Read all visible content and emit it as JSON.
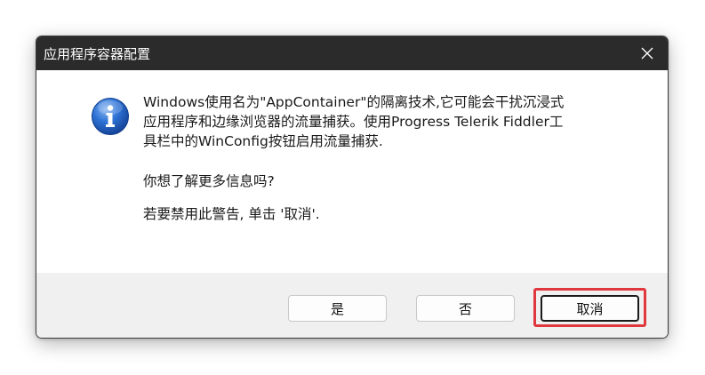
{
  "window": {
    "title": "应用程序容器配置"
  },
  "message": {
    "lines": [
      "Windows使用名为\"AppContainer\"的隔离技术,它可能会干扰沉浸式",
      "应用程序和边缘浏览器的流量捕获。使用Progress Telerik Fiddler工",
      "具栏中的WinConfig按钮启用流量捕获."
    ],
    "question": "你想了解更多信息吗?",
    "hint": "若要禁用此警告, 单击 '取消'."
  },
  "buttons": {
    "yes": "是",
    "no": "否",
    "cancel": "取消"
  },
  "icons": {
    "close": "close-icon",
    "info": "info-icon"
  },
  "colors": {
    "titlebar": "#2b2b2b",
    "highlight": "#e0383d",
    "info_blue": "#1d5fc4"
  }
}
